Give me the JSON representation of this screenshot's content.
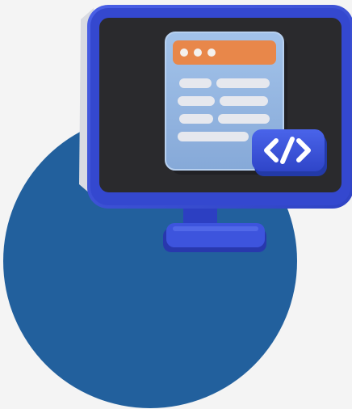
{
  "illustration": {
    "subject": "monitor-with-code-window",
    "icons": {
      "circle": "backdrop-circle",
      "monitor": "monitor-icon",
      "window": "browser-window-icon",
      "code_badge": "code-tag-icon"
    },
    "colors": {
      "background": "#f4f4f4",
      "circle": "#22609d",
      "monitor_frame": "#3b50d6",
      "monitor_frame_dark": "#2a3cb4",
      "screen": "#2a2a2d",
      "window_panel": "#94b7e2",
      "window_titlebar": "#e8874a",
      "text_lines": "#e6e8ee",
      "code_badge": "#3b55e0",
      "code_glyph": "#ffffff"
    }
  }
}
